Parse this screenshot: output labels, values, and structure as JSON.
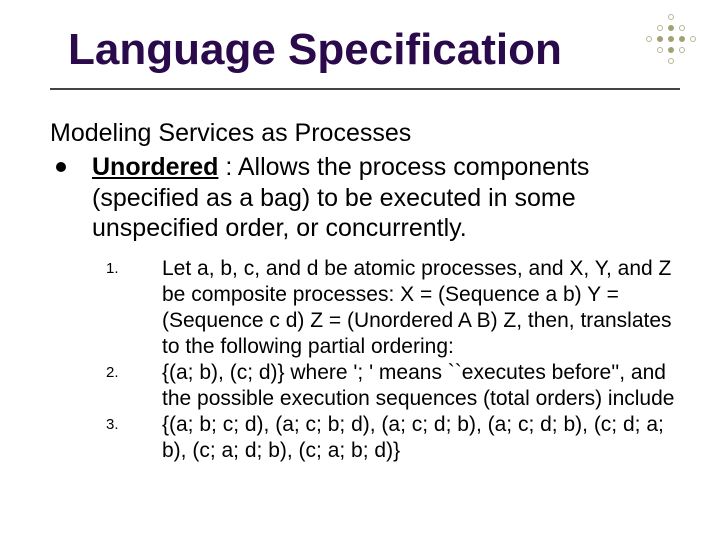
{
  "title": "Language Specification",
  "subtitle": "Modeling Services as Processes",
  "bullet": {
    "key": "Unordered",
    "rest": " : Allows the process components (specified as a bag) to be executed in some unspecified order, or concurrently."
  },
  "items": [
    {
      "n": "1.",
      "text": "Let a, b, c, and d be atomic processes, and X, Y, and Z be composite processes: X = (Sequence a b) Y = (Sequence c d) Z = (Unordered A B) Z, then, translates to the following partial ordering:"
    },
    {
      "n": "2.",
      "text": "{(a; b), (c; d)} where '; ' means ``executes before'', and the possible execution sequences (total orders) include"
    },
    {
      "n": "3.",
      "text": "{(a; b; c; d), (a; c; b; d), (a; c; d; b), (a; c; d; b), (c; d; a; b), (c; a; d; b), (c; a; b; d)}"
    }
  ]
}
